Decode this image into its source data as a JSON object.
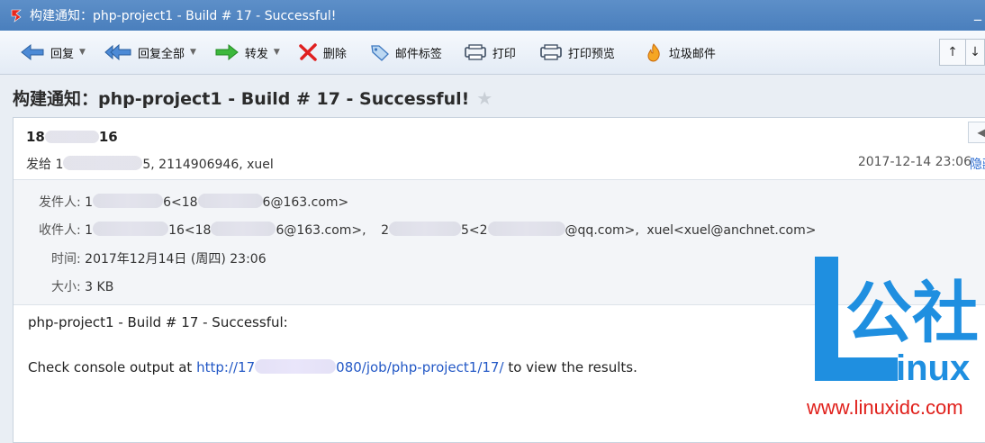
{
  "window": {
    "title": "构建通知：php-project1 - Build # 17 - Successful!"
  },
  "toolbar": {
    "reply": "回复",
    "reply_all": "回复全部",
    "forward": "转发",
    "delete": "删除",
    "tag": "邮件标签",
    "print": "打印",
    "print_preview": "打印预览",
    "spam": "垃圾邮件"
  },
  "subject": "构建通知：php-project1 - Build # 17 - Successful!",
  "header": {
    "sender_name_a": "18",
    "sender_name_b": "16",
    "to_label": "发给 1",
    "to_mid": "5, 2114906946, xuel",
    "date": "2017-12-14 23:06",
    "hide_link": "隐藏"
  },
  "meta": {
    "from_label": "发件人:",
    "from_a": "1",
    "from_b": "6<18",
    "from_c": "6@163.com>",
    "to_label": "收件人:",
    "to_a": "1",
    "to_b": "16<18",
    "to_c": "6@163.com>,",
    "to_d": "2",
    "to_e": "5<2",
    "to_f": "@qq.com>,",
    "to_g": "xuel<xuel@anchnet.com>",
    "time_label": "时间:",
    "time_value": "2017年12月14日 (周四) 23:06",
    "size_label": "大小:",
    "size_value": "3 KB"
  },
  "body": {
    "line1": "php-project1 - Build # 17 - Successful:",
    "line2_pre": "Check console output at",
    "link_a": "http://17",
    "link_b": "080/job/php-project1/17/",
    "line2_post": "to view the results."
  },
  "watermark": {
    "chars": "公社",
    "inux": "inux",
    "url": "www.linuxidc.com"
  },
  "colors": {
    "titlebar": "#4a7fbd",
    "link": "#2459c6",
    "watermark_blue": "#1f8fe0",
    "watermark_red": "#e0201b"
  }
}
